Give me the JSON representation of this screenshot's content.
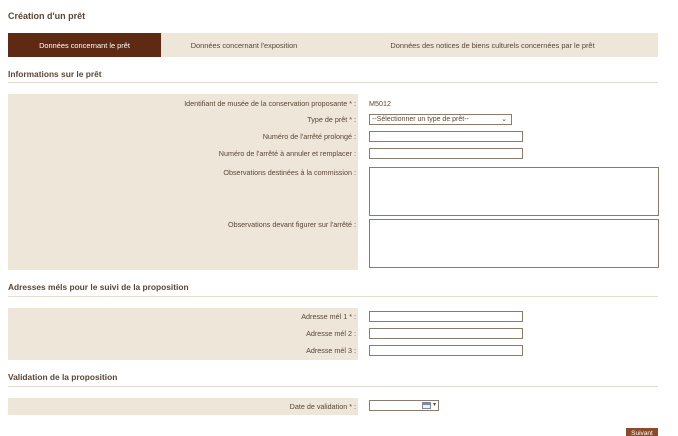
{
  "page": {
    "title": "Création d'un prêt"
  },
  "tabs": [
    {
      "label": "Données concernant le prêt",
      "active": true
    },
    {
      "label": "Données concernant l'exposition",
      "active": false
    },
    {
      "label": "Données des notices de biens culturels concernées par le prêt",
      "active": false
    }
  ],
  "loan_info": {
    "title": "Informations sur le prêt",
    "museum_id_label": "Identifiant de musée de la conservation proposante * :",
    "museum_id_value": "M5012",
    "loan_type_label": "Type de prêt * :",
    "loan_type_selected": "--Sélectionner un type de prêt--",
    "extended_decree_label": "Numéro de l'arrêté prolongé :",
    "cancel_decree_label": "Numéro de l'arrêté à annuler et remplacer :",
    "commission_obs_label": "Observations destinées à la commission :",
    "decree_obs_label": "Observations devant figurer sur l'arrêté :"
  },
  "emails": {
    "title": "Adresses méls pour le suivi de la proposition",
    "email1_label": "Adresse mél 1 * :",
    "email2_label": "Adresse mél 2 :",
    "email3_label": "Adresse mél 3 :"
  },
  "validation": {
    "title": "Validation de la proposition",
    "date_label": "Date de validation * :"
  },
  "actions": {
    "submit_label": "Suivant"
  },
  "colors": {
    "active_tab": "#5e2a14",
    "label_column": "#ede6d9",
    "text": "#5a4636"
  },
  "icons": {
    "date_picker": "calendar-icon",
    "dropdown": "chevron-down-icon"
  }
}
